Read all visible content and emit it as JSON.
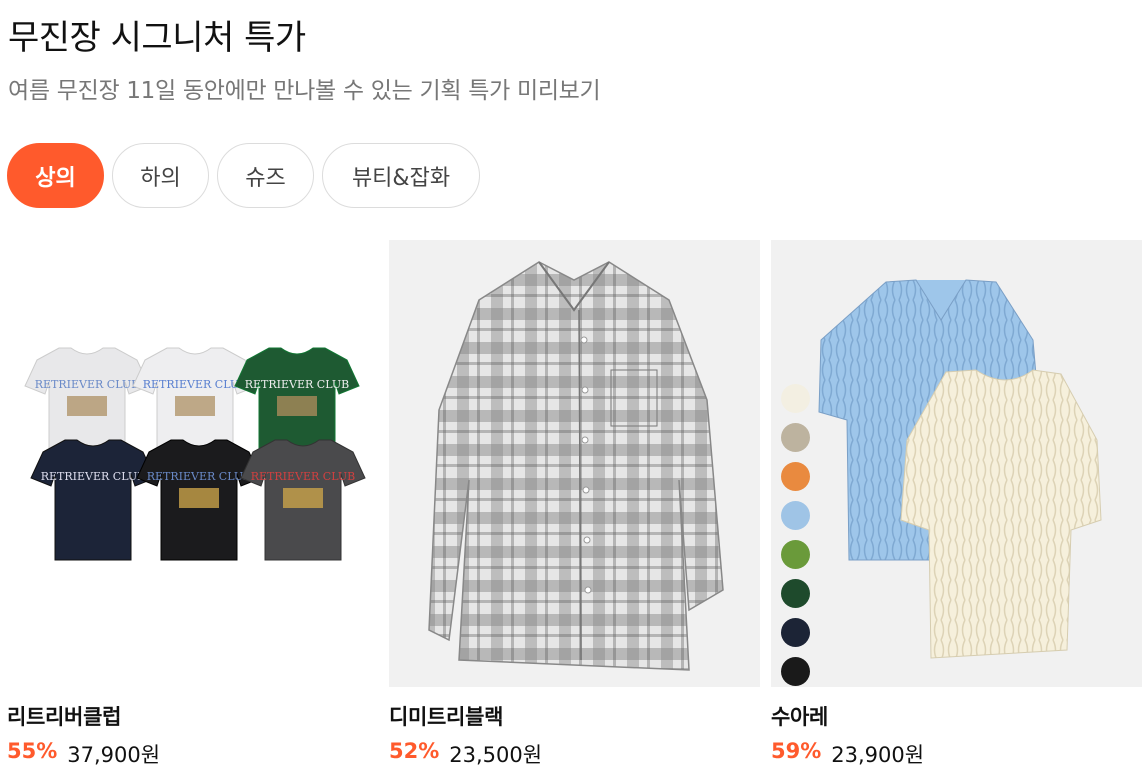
{
  "header": {
    "title": "무진장 시그니처 특가",
    "subtitle": "여름 무진장 11일 동안에만 만나볼 수 있는 기획 특가 미리보기"
  },
  "tabs": [
    {
      "label": "상의",
      "active": true
    },
    {
      "label": "하의",
      "active": false
    },
    {
      "label": "슈즈",
      "active": false
    },
    {
      "label": "뷰티&잡화",
      "active": false
    }
  ],
  "products": [
    {
      "brand": "리트리버클럽",
      "discount": "55%",
      "price": "37,900원",
      "image": "six t-shirts in white, green, navy, black, charcoal with RETRIEVER CLUB print"
    },
    {
      "brand": "디미트리블랙",
      "discount": "52%",
      "price": "23,500원",
      "image": "grey and white ombre check long-sleeve shirt"
    },
    {
      "brand": "수아레",
      "discount": "59%",
      "price": "23,900원",
      "image": "light blue cable knit polo and cream cable knit tee"
    }
  ],
  "colors": {
    "accent": "#ff5a2c",
    "swatches": [
      "#f3efe2",
      "#bdb39f",
      "#e98a3f",
      "#9fc4e6",
      "#6a9a3a",
      "#1e4a2c",
      "#1c2436",
      "#1a1a1a"
    ]
  }
}
